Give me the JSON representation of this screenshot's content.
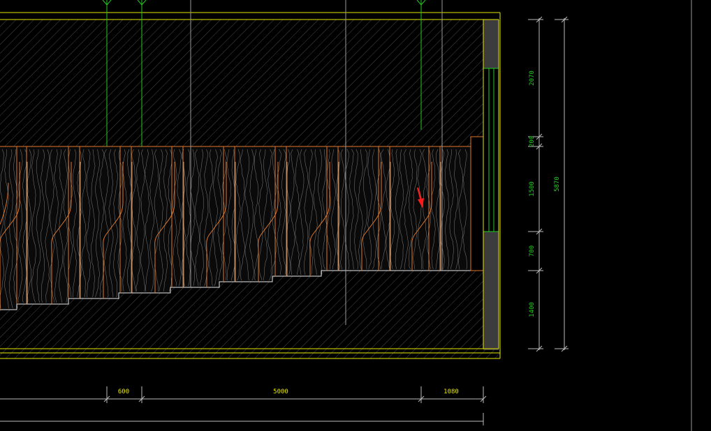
{
  "drawing": {
    "colors": {
      "background": "#000000",
      "outline": "#e8e800",
      "hatch": "#4a4a4a",
      "panel_edge": "#e0782a",
      "grain": "#9a9a9a",
      "green": "#22cc22",
      "dim_line": "#bcbcbc",
      "wall": "#3c3c3c",
      "arrow": "#ff1a1a",
      "dim_text_h": "#e8e800",
      "dim_text_v": "#22cc22"
    },
    "horizontal_dimensions": [
      "600",
      "5000",
      "1080"
    ],
    "vertical_dimensions": [
      "2070",
      "200",
      "1500",
      "700",
      "1400"
    ],
    "overall_height": "5870"
  }
}
